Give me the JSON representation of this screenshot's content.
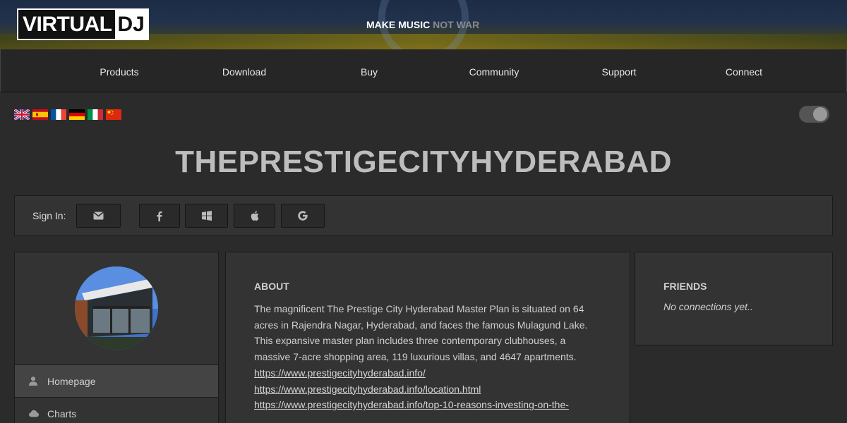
{
  "header": {
    "logo_left": "VIRTUAL",
    "logo_right": "DJ",
    "slogan_main": "MAKE MUSIC",
    "slogan_accent": "NOT WAR"
  },
  "nav": {
    "items": [
      {
        "label": "Products"
      },
      {
        "label": "Download"
      },
      {
        "label": "Buy"
      },
      {
        "label": "Community"
      },
      {
        "label": "Support"
      },
      {
        "label": "Connect"
      }
    ]
  },
  "languages": [
    "english-flag-icon",
    "spanish-flag-icon",
    "french-flag-icon",
    "german-flag-icon",
    "italian-flag-icon",
    "chinese-flag-icon"
  ],
  "theme_toggle": {
    "state": "on"
  },
  "profile": {
    "title": "THEPRESTIGECITYHYDERABAD"
  },
  "signin": {
    "label": "Sign In:",
    "methods": [
      "email-icon",
      "facebook-icon",
      "windows-icon",
      "apple-icon",
      "google-icon"
    ]
  },
  "sidebar": {
    "items": [
      {
        "label": "Homepage",
        "icon": "user-icon",
        "active": true
      },
      {
        "label": "Charts",
        "icon": "cloud-icon",
        "active": false
      }
    ]
  },
  "about": {
    "heading": "ABOUT",
    "text": "The magnificent The Prestige City Hyderabad Master Plan is situated on 64 acres in Rajendra Nagar, Hyderabad, and faces the famous Mulagund Lake. This expansive master plan includes three contemporary clubhouses, a massive 7-acre shopping area, 119 luxurious villas, and 4647 apartments.",
    "links": [
      "https://www.prestigecityhyderabad.info/",
      "https://www.prestigecityhyderabad.info/location.html",
      "https://www.prestigecityhyderabad.info/top-10-reasons-investing-on-the-"
    ]
  },
  "friends": {
    "heading": "FRIENDS",
    "empty_text": "No connections yet.."
  },
  "colors": {
    "background": "#2b2b2b",
    "panel": "#333333",
    "nav": "#262626",
    "title": "#bdbdbd"
  }
}
